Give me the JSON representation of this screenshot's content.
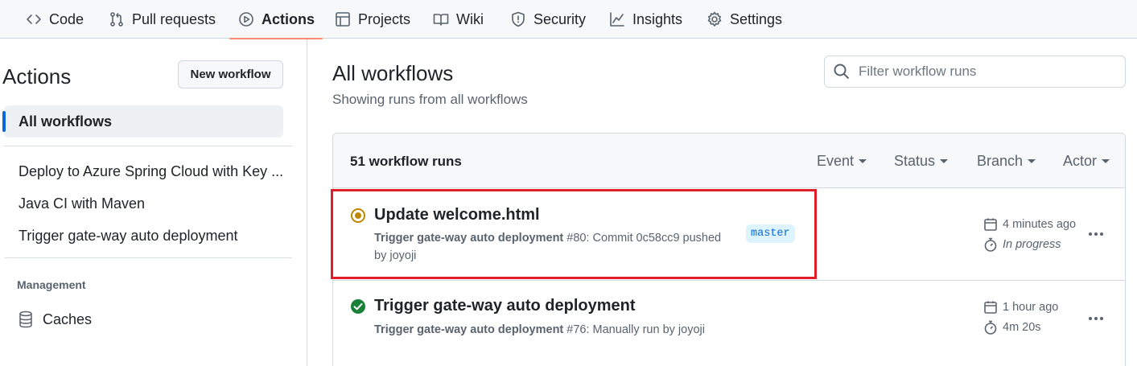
{
  "nav": {
    "items": [
      {
        "label": "Code",
        "icon": "code-icon"
      },
      {
        "label": "Pull requests",
        "icon": "git-pull-request-icon"
      },
      {
        "label": "Actions",
        "icon": "play-icon",
        "active": true
      },
      {
        "label": "Projects",
        "icon": "table-icon"
      },
      {
        "label": "Wiki",
        "icon": "book-icon"
      },
      {
        "label": "Security",
        "icon": "shield-icon"
      },
      {
        "label": "Insights",
        "icon": "graph-icon"
      },
      {
        "label": "Settings",
        "icon": "gear-icon"
      }
    ]
  },
  "sidebar": {
    "title": "Actions",
    "new_workflow_label": "New workflow",
    "all_workflows_label": "All workflows",
    "workflows": [
      "Deploy to Azure Spring Cloud with Key ...",
      "Java CI with Maven",
      "Trigger gate-way auto deployment"
    ],
    "management_label": "Management",
    "caches_label": "Caches"
  },
  "main": {
    "title": "All workflows",
    "subtitle": "Showing runs from all workflows",
    "filter_placeholder": "Filter workflow runs",
    "runs_count": "51 workflow runs",
    "filters": [
      "Event",
      "Status",
      "Branch",
      "Actor"
    ],
    "runs": [
      {
        "title": "Update welcome.html",
        "workflow": "Trigger gate-way auto deployment",
        "detail_line1": " #80: Commit 0c58cc9 pushed",
        "detail_line2": "by joyoji",
        "branch": "master",
        "time": "4 minutes ago",
        "duration": "In progress",
        "status": "in-progress"
      },
      {
        "title": "Trigger gate-way auto deployment",
        "workflow": "Trigger gate-way auto deployment",
        "detail_line1": " #76: Manually run by joyoji",
        "time": "1 hour ago",
        "duration": "4m 20s",
        "status": "success"
      }
    ]
  },
  "colors": {
    "accent_blue": "#0969da",
    "in_progress": "#bf8700",
    "success": "#1a7f37",
    "highlight_red": "#e01e2a",
    "tab_underline": "#fd8c73"
  }
}
